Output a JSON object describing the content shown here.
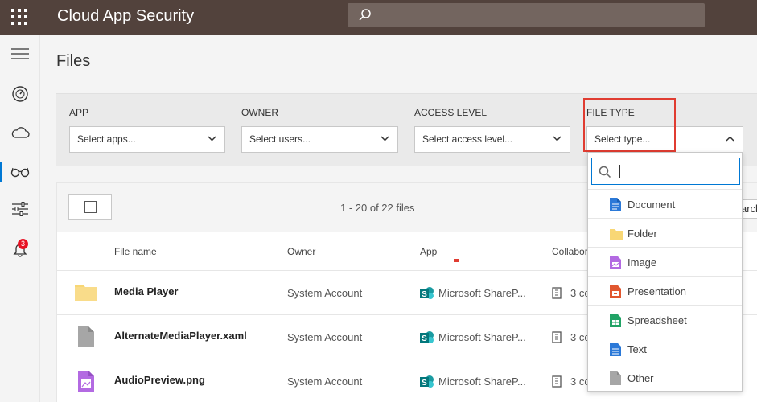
{
  "header": {
    "app_title": "Cloud App Security",
    "search_icon": "search-icon",
    "waffle_icon": "waffle-icon"
  },
  "rail": {
    "items": [
      {
        "icon": "hamburger-menu-icon"
      },
      {
        "icon": "dashboard-gauge-icon"
      },
      {
        "icon": "cloud-icon"
      },
      {
        "icon": "glasses-investigate-icon",
        "active": true
      },
      {
        "icon": "sliders-control-icon"
      },
      {
        "icon": "bell-alerts-icon",
        "badge": "3"
      }
    ]
  },
  "page": {
    "title": "Files"
  },
  "filters": {
    "app": {
      "label": "APP",
      "placeholder": "Select apps..."
    },
    "owner": {
      "label": "OWNER",
      "placeholder": "Select users..."
    },
    "access": {
      "label": "ACCESS LEVEL",
      "placeholder": "Select access level..."
    },
    "file_type": {
      "label": "FILE TYPE",
      "placeholder": "Select type..."
    }
  },
  "table": {
    "count_text": "1 - 20 of 22 files",
    "search_partial": "arch",
    "columns": {
      "file_name": "File name",
      "owner": "Owner",
      "app": "App",
      "collaborators": "Collabor"
    },
    "rows": [
      {
        "name": "Media Player",
        "owner": "System Account",
        "app": "Microsoft ShareP...",
        "collab": "3 co",
        "type": "folder"
      },
      {
        "name": "AlternateMediaPlayer.xaml",
        "owner": "System Account",
        "app": "Microsoft ShareP...",
        "collab": "3 co",
        "type": "other"
      },
      {
        "name": "AudioPreview.png",
        "owner": "System Account",
        "app": "Microsoft ShareP...",
        "collab": "3 co",
        "type": "image"
      }
    ]
  },
  "dropdown": {
    "search_value": "",
    "options": [
      {
        "label": "Document",
        "icon": "document-icon",
        "color": "#2b79d8"
      },
      {
        "label": "Folder",
        "icon": "folder-icon",
        "color": "#f8d775"
      },
      {
        "label": "Image",
        "icon": "image-icon",
        "color": "#b36ae2"
      },
      {
        "label": "Presentation",
        "icon": "presentation-icon",
        "color": "#e1572f"
      },
      {
        "label": "Spreadsheet",
        "icon": "spreadsheet-icon",
        "color": "#21a366"
      },
      {
        "label": "Text",
        "icon": "text-icon",
        "color": "#2b79d8"
      },
      {
        "label": "Other",
        "icon": "other-file-icon",
        "color": "#a6a6a6"
      }
    ]
  },
  "colors": {
    "topbar": "#52423c",
    "accent": "#0078d4",
    "highlight": "#e03c31",
    "badge": "#e81123"
  }
}
